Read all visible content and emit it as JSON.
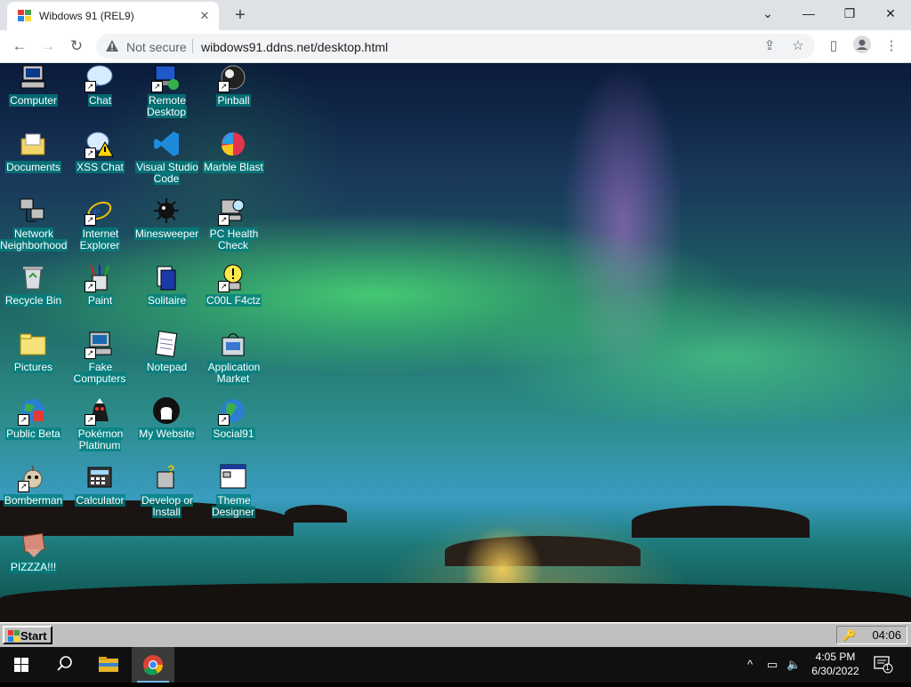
{
  "browser": {
    "tab_title": "Wibdows 91 (REL9)",
    "tab_close": "✕",
    "new_tab": "+",
    "window_controls": {
      "minimize": "—",
      "restore": "❐",
      "close": "✕",
      "tabsearch": "⌄"
    },
    "security_label": "Not secure",
    "url": "wibdows91.ddns.net/desktop.html"
  },
  "desktop": {
    "icons": [
      {
        "label": "Computer",
        "icon": "computer-icon"
      },
      {
        "label": "Chat",
        "icon": "chat-icon"
      },
      {
        "label": "Remote Desktop",
        "icon": "remote-desktop-icon"
      },
      {
        "label": "Pinball",
        "icon": "pinball-icon"
      },
      {
        "label": "Documents",
        "icon": "documents-folder-icon"
      },
      {
        "label": "XSS Chat",
        "icon": "xss-chat-icon"
      },
      {
        "label": "Visual Studio Code",
        "icon": "vscode-icon"
      },
      {
        "label": "Marble Blast",
        "icon": "marble-blast-icon"
      },
      {
        "label": "Network Neighborhood",
        "icon": "network-icon"
      },
      {
        "label": "Internet Explorer",
        "icon": "internet-explorer-icon"
      },
      {
        "label": "Minesweeper",
        "icon": "minesweeper-icon"
      },
      {
        "label": "PC Health Check",
        "icon": "pc-health-check-icon"
      },
      {
        "label": "Recycle Bin",
        "icon": "recycle-bin-icon"
      },
      {
        "label": "Paint",
        "icon": "paint-icon"
      },
      {
        "label": "Solitaire",
        "icon": "solitaire-icon"
      },
      {
        "label": "C00L F4ctz",
        "icon": "cool-facts-icon"
      },
      {
        "label": "Pictures",
        "icon": "pictures-folder-icon"
      },
      {
        "label": "Fake Computers",
        "icon": "fake-computers-icon"
      },
      {
        "label": "Notepad",
        "icon": "notepad-icon"
      },
      {
        "label": "Application Market",
        "icon": "application-market-icon"
      },
      {
        "label": "Public Beta",
        "icon": "public-beta-icon"
      },
      {
        "label": "Pokémon Platinum",
        "icon": "pokemon-icon"
      },
      {
        "label": "My Website",
        "icon": "github-icon"
      },
      {
        "label": "Social91",
        "icon": "social91-icon"
      },
      {
        "label": "Bomberman",
        "icon": "bomberman-icon"
      },
      {
        "label": "Calculator",
        "icon": "calculator-icon"
      },
      {
        "label": "Develop or Install",
        "icon": "develop-install-icon"
      },
      {
        "label": "Theme Designer",
        "icon": "theme-designer-icon"
      },
      {
        "label": "PIZZZA!!!",
        "icon": "pizza-icon"
      }
    ]
  },
  "w9taskbar": {
    "start_label": "Start",
    "clock": "04:06"
  },
  "w10taskbar": {
    "time": "4:05 PM",
    "date": "6/30/2022",
    "notification_count": "1"
  }
}
